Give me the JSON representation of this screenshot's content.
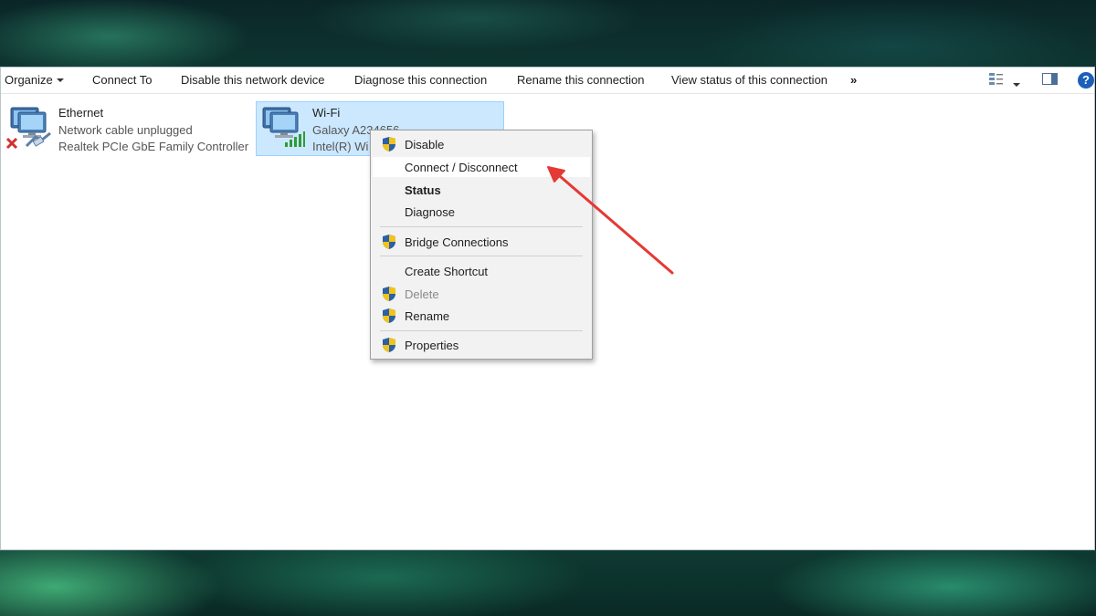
{
  "toolbar": {
    "organize": "Organize",
    "connect_to": "Connect To",
    "disable_device": "Disable this network device",
    "diagnose": "Diagnose this connection",
    "rename": "Rename this connection",
    "view_status": "View status of this connection",
    "more": "»",
    "help": "?"
  },
  "adapters": {
    "ethernet": {
      "name": "Ethernet",
      "status": "Network cable unplugged",
      "device": "Realtek PCIe GbE Family Controller"
    },
    "wifi": {
      "name": "Wi-Fi",
      "status": "Galaxy A234656",
      "device": "Intel(R) Wi"
    }
  },
  "context_menu": {
    "disable": "Disable",
    "connect_disconnect": "Connect / Disconnect",
    "status": "Status",
    "diagnose": "Diagnose",
    "bridge": "Bridge Connections",
    "create_shortcut": "Create Shortcut",
    "delete": "Delete",
    "rename": "Rename",
    "properties": "Properties"
  },
  "colors": {
    "selection": "#cce8ff",
    "annotation_arrow": "#e53935",
    "help_blue": "#1b5fb8"
  }
}
